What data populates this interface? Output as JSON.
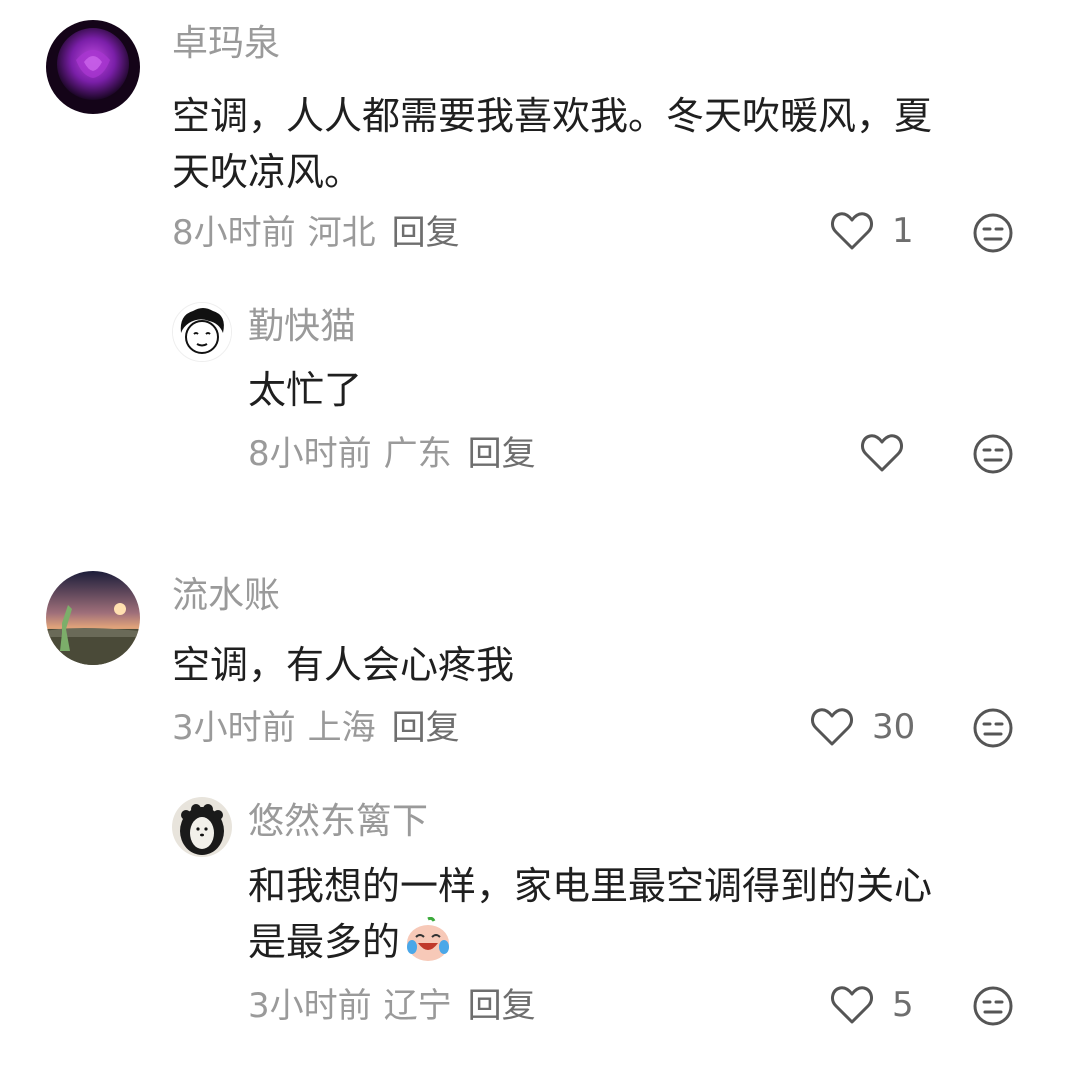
{
  "comments": [
    {
      "name": "卓玛泉",
      "text_line1": "空调，人人都需要我喜欢我。冬天吹暖风，夏",
      "text_line2": "天吹凉风。",
      "time": "8小时前",
      "location": "河北",
      "reply": "回复",
      "likes": "1",
      "avatar": "purple-rose-avatar"
    },
    {
      "name": "勤快猫",
      "text": "太忙了",
      "time": "8小时前",
      "location": "广东",
      "reply": "回复",
      "likes": "",
      "avatar": "sketch-face-avatar"
    },
    {
      "name": "流水账",
      "text": "空调，有人会心疼我",
      "time": "3小时前",
      "location": "上海",
      "reply": "回复",
      "likes": "30",
      "avatar": "sunset-landscape-avatar"
    },
    {
      "name": "悠然东篱下",
      "text_line1": "和我想的一样，家电里最空调得到的关心",
      "text_line2": "是最多的",
      "time": "3小时前",
      "location": "辽宁",
      "reply": "回复",
      "likes": "5",
      "avatar": "curly-hair-dog-avatar",
      "emoji": "crying-laughing-emoji"
    }
  ],
  "icons": {
    "like": "heart-outline-icon",
    "dislike": "neutral-face-icon"
  },
  "colors": {
    "name": "#9a9a9a",
    "text": "#1f1f1f",
    "meta": "#9a9a9a",
    "icon": "#555555"
  }
}
